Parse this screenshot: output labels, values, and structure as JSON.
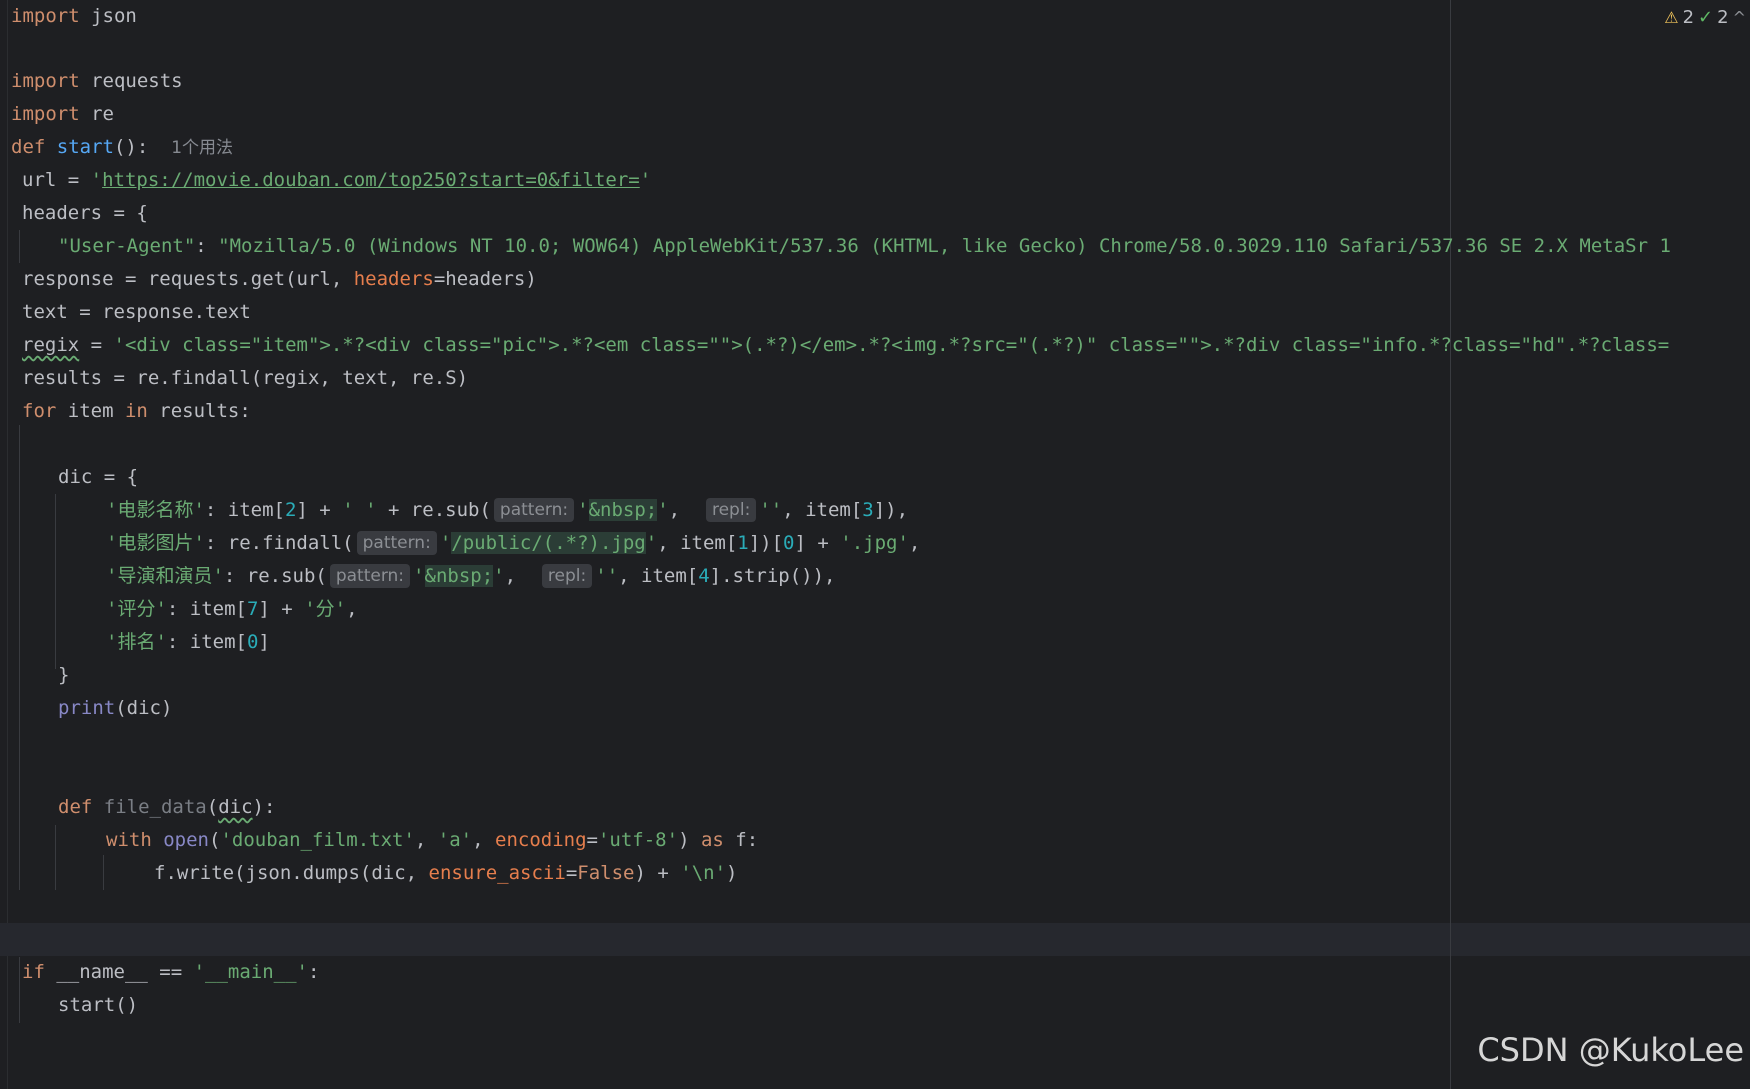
{
  "status": {
    "warnings_count": "2",
    "checks_count": "2",
    "chevron_glyph": "^"
  },
  "usages_hint": "1个用法",
  "inlay": {
    "pattern": "pattern:",
    "repl": "repl:"
  },
  "code": {
    "l1_module": "json",
    "l3_module": "requests",
    "l4_module": "re",
    "l5_func": "start",
    "l6_url": "https://movie.douban.com/top250?start=0&filter=",
    "l8_key": "\"User-Agent\"",
    "l8_value": "\"Mozilla/5.0 (Windows NT 10.0; WOW64) AppleWebKit/537.36 (KHTML, like Gecko) Chrome/58.0.3029.110 Safari/537.36 SE 2.X MetaSr 1",
    "l11_regex": "'<div class=\"item\">.*?<div class=\"pic\">.*?<em class=\"\">(.*?)</em>.*?<img.*?src=\"(.*?)\" class=\"\">.*?div class=\"info.*?class=\"hd\".*?class=",
    "k_name": "'电影名称'",
    "k_pic": "'电影图片'",
    "k_dir": "'导演和演员'",
    "k_score": "'评分'",
    "k_rank": "'排名'",
    "nbsp": "&nbsp;",
    "jpg_regex": "/public/(.*?).jpg",
    "jpg_ext": "'.jpg'",
    "fen": "'分'",
    "file_func": "file_data",
    "filename": "'douban_film.txt'",
    "mode": "'a'",
    "encoding_val": "'utf-8'",
    "newline": "'\\n'",
    "main_str": "'__main__'"
  },
  "watermark": "CSDN @KukoLee"
}
